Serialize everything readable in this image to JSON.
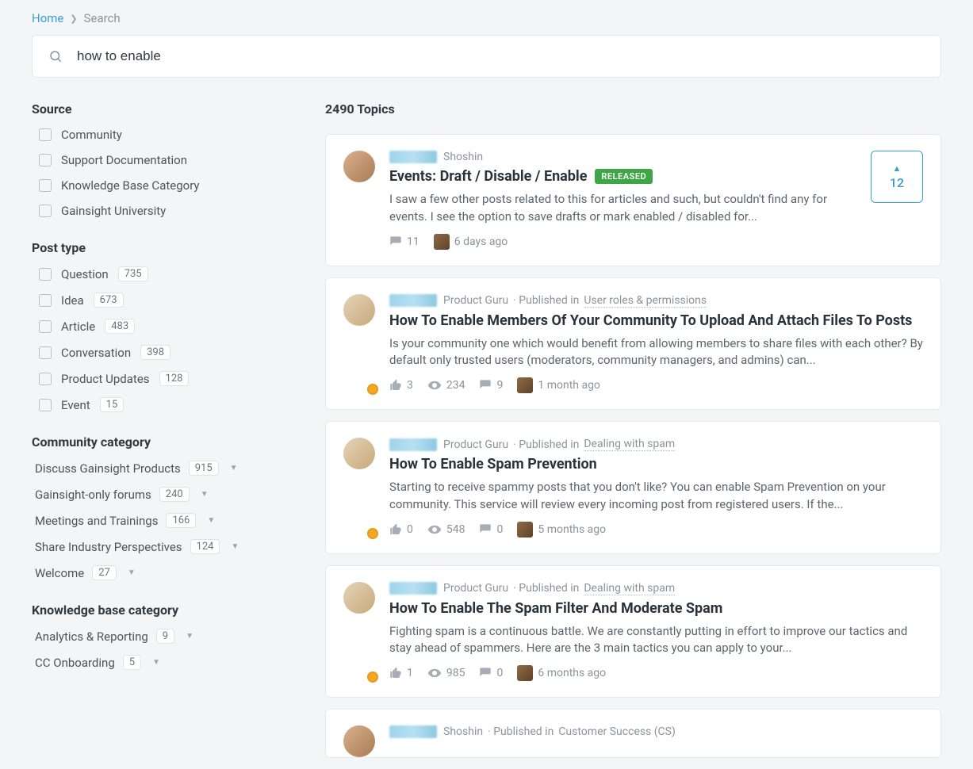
{
  "breadcrumb": {
    "home": "Home",
    "current": "Search"
  },
  "search": {
    "value": "how to enable"
  },
  "filters": {
    "source": {
      "title": "Source",
      "items": [
        {
          "label": "Community"
        },
        {
          "label": "Support Documentation"
        },
        {
          "label": "Knowledge Base Category"
        },
        {
          "label": "Gainsight University"
        }
      ]
    },
    "post_type": {
      "title": "Post type",
      "items": [
        {
          "label": "Question",
          "count": "735"
        },
        {
          "label": "Idea",
          "count": "673"
        },
        {
          "label": "Article",
          "count": "483"
        },
        {
          "label": "Conversation",
          "count": "398"
        },
        {
          "label": "Product Updates",
          "count": "128"
        },
        {
          "label": "Event",
          "count": "15"
        }
      ]
    },
    "community_cat": {
      "title": "Community category",
      "items": [
        {
          "label": "Discuss Gainsight Products",
          "count": "915"
        },
        {
          "label": "Gainsight-only forums",
          "count": "240"
        },
        {
          "label": "Meetings and Trainings",
          "count": "166"
        },
        {
          "label": "Share Industry Perspectives",
          "count": "124"
        },
        {
          "label": "Welcome",
          "count": "27"
        }
      ]
    },
    "kb_cat": {
      "title": "Knowledge base category",
      "items": [
        {
          "label": "Analytics & Reporting",
          "count": "9"
        },
        {
          "label": "CC Onboarding",
          "count": "5"
        }
      ]
    }
  },
  "results": {
    "count_label": "2490 Topics",
    "items": [
      {
        "role": "Shoshin",
        "title": "Events: Draft / Disable / Enable",
        "tag": "RELEASED",
        "excerpt": "I saw a few other posts related to this for articles and such, but couldn't find any for events. I see the option to save drafts or mark enabled / disabled for...",
        "comments": "11",
        "time": "6 days ago",
        "votes": "12"
      },
      {
        "role": "Product Guru",
        "published_in": "User roles & permissions",
        "title": "How To Enable Members Of Your Community To Upload And Attach Files To Posts",
        "excerpt": "Is your community one which would benefit from allowing members to share files with each other? By default only trusted users (moderators, community managers, and admins) can...",
        "likes": "3",
        "views": "234",
        "comments": "9",
        "time": "1 month ago"
      },
      {
        "role": "Product Guru",
        "published_in": "Dealing with spam",
        "title": "How To Enable Spam Prevention",
        "excerpt": "Starting to receive spammy posts that you don't like? You can enable Spam Prevention on your community. This service will review every incoming post from registered users. If the...",
        "likes": "0",
        "views": "548",
        "comments": "0",
        "time": "5 months ago"
      },
      {
        "role": "Product Guru",
        "published_in": "Dealing with spam",
        "title": "How To Enable The Spam Filter And Moderate Spam",
        "excerpt": "Fighting spam is a continuous battle. We are constantly putting in effort to improve our tactics and stay ahead of spammers. Here are the 3 main tactics you can apply to your...",
        "likes": "1",
        "views": "985",
        "comments": "0",
        "time": "6 months ago"
      },
      {
        "role": "Shoshin",
        "published_in": "Customer Success (CS)"
      }
    ]
  }
}
